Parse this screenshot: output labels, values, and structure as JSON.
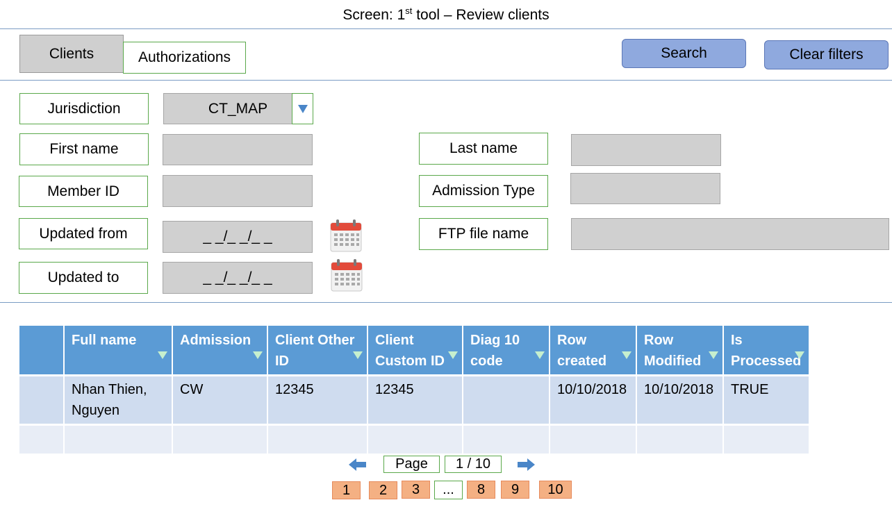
{
  "screen_title": {
    "prefix": "Screen: 1",
    "sup": "st",
    "suffix": " tool – Review clients"
  },
  "tabs": [
    {
      "label": "Clients",
      "active": true
    },
    {
      "label": "Authorizations",
      "active": false
    }
  ],
  "buttons": {
    "search": "Search",
    "clear": "Clear filters"
  },
  "filters": {
    "jurisdiction_label": "Jurisdiction",
    "jurisdiction_value": "CT_MAP",
    "first_name_label": "First name",
    "first_name_value": "",
    "last_name_label": "Last name",
    "last_name_value": "",
    "member_id_label": "Member ID",
    "member_id_value": "",
    "admission_type_label": "Admission Type",
    "admission_type_value": "",
    "updated_from_label": "Updated from",
    "updated_from_value": "_ _/_ _/_ _",
    "ftp_label": "FTP file name",
    "ftp_value": "",
    "updated_to_label": "Updated to",
    "updated_to_value": "_ _/_ _/_ _"
  },
  "table": {
    "headers": [
      "",
      "Full name",
      "Admission",
      "Client Other ID",
      "Client Custom ID",
      "Diag 10 code",
      "Row created",
      "Row Modified",
      "Is Processed"
    ],
    "rows": [
      [
        "",
        "Nhan Thien, Nguyen",
        "CW",
        "12345",
        "12345",
        "",
        "10/10/2018",
        "10/10/2018",
        "TRUE"
      ],
      [
        "",
        "",
        "",
        "",
        "",
        "",
        "",
        "",
        ""
      ]
    ]
  },
  "pagination": {
    "page_label": "Page",
    "page_value": "1 / 10",
    "numbers": [
      "1",
      "2",
      "3",
      "...",
      "8",
      "9",
      "10"
    ]
  },
  "colors": {
    "header_blue": "#5b9bd5",
    "button_blue": "#8fa9de",
    "page_orange": "#f4b083",
    "border_green": "#5aa84a"
  },
  "icons": [
    "calendar-icon",
    "arrow-left-icon",
    "arrow-right-icon",
    "dropdown-arrow-icon",
    "filter-icon"
  ]
}
